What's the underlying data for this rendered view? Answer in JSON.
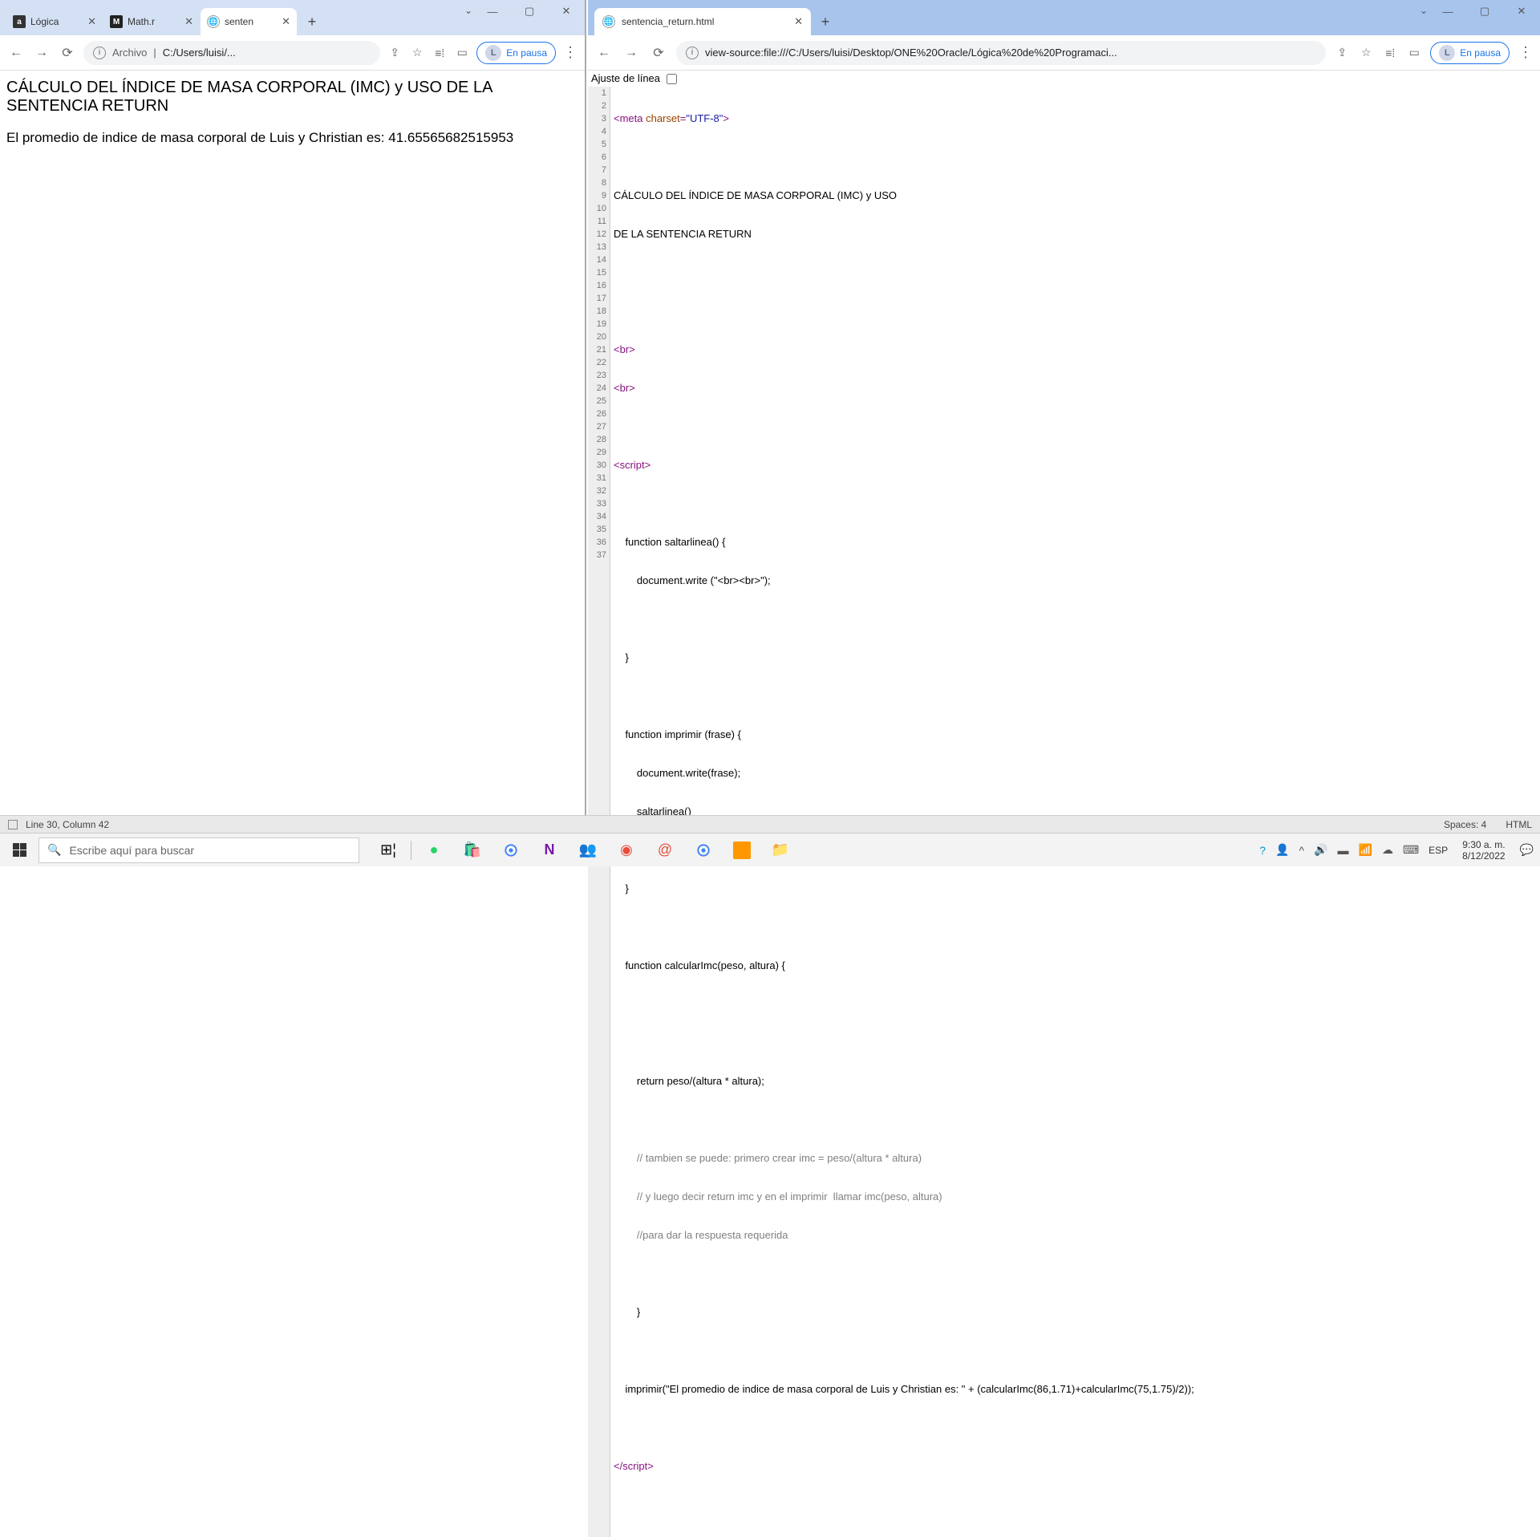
{
  "left": {
    "tabs": [
      {
        "title": "Lógica"
      },
      {
        "title": "Math.r"
      },
      {
        "title": "senten"
      }
    ],
    "addr_prefix": "Archivo",
    "addr_path": "C:/Users/luisi/...",
    "pausa": "En pausa",
    "pausa_initial": "L",
    "content": {
      "heading": "CÁLCULO DEL ÍNDICE DE MASA CORPORAL (IMC) y USO DE LA SENTENCIA RETURN",
      "paragraph": "El promedio de indice de masa corporal de Luis y Christian es: 41.65565682515953"
    }
  },
  "right": {
    "tab_title": "sentencia_return.html",
    "addr": "view-source:file:///C:/Users/luisi/Desktop/ONE%20Oracle/Lógica%20de%20Programaci...",
    "pausa": "En pausa",
    "pausa_initial": "L",
    "ajuste_label": "Ajuste de línea",
    "code": {
      "l1_tag_open": "<meta ",
      "l1_attr": "charset",
      "l1_val": "\"UTF-8\"",
      "l1_tag_close": ">",
      "l3": "CÁLCULO DEL ÍNDICE DE MASA CORPORAL (IMC) y USO",
      "l4": "DE LA SENTENCIA RETURN",
      "l7": "<br>",
      "l8": "<br>",
      "l10": "<script>",
      "l12": "    function saltarlinea() {",
      "l13": "        document.write (\"<br><br>\");",
      "l15": "    }",
      "l17": "    function imprimir (frase) {",
      "l18": "        document.write(frase);",
      "l19": "        saltarlinea()",
      "l21": "    }",
      "l23": "    function calcularImc(peso, altura) {",
      "l26": "        return peso/(altura * altura);",
      "l28": "        // tambien se puede: primero crear imc = peso/(altura * altura)",
      "l29": "        // y luego decir return imc y en el imprimir  llamar imc(peso, altura)",
      "l30": "        //para dar la respuesta requerida",
      "l32": "        }",
      "l34": "    imprimir(\"El promedio de indice de masa corporal de Luis y Christian es: \" + (calcularImc(86,1.71)+calcularImc(75,1.75)/2));",
      "l36_close": "</script>"
    }
  },
  "statusbar": {
    "pos": "Line 30, Column 42",
    "spaces": "Spaces: 4",
    "lang": "HTML"
  },
  "taskbar": {
    "search_placeholder": "Escribe aquí para buscar",
    "lang": "ESP",
    "time": "9:30 a. m.",
    "date": "8/12/2022"
  }
}
